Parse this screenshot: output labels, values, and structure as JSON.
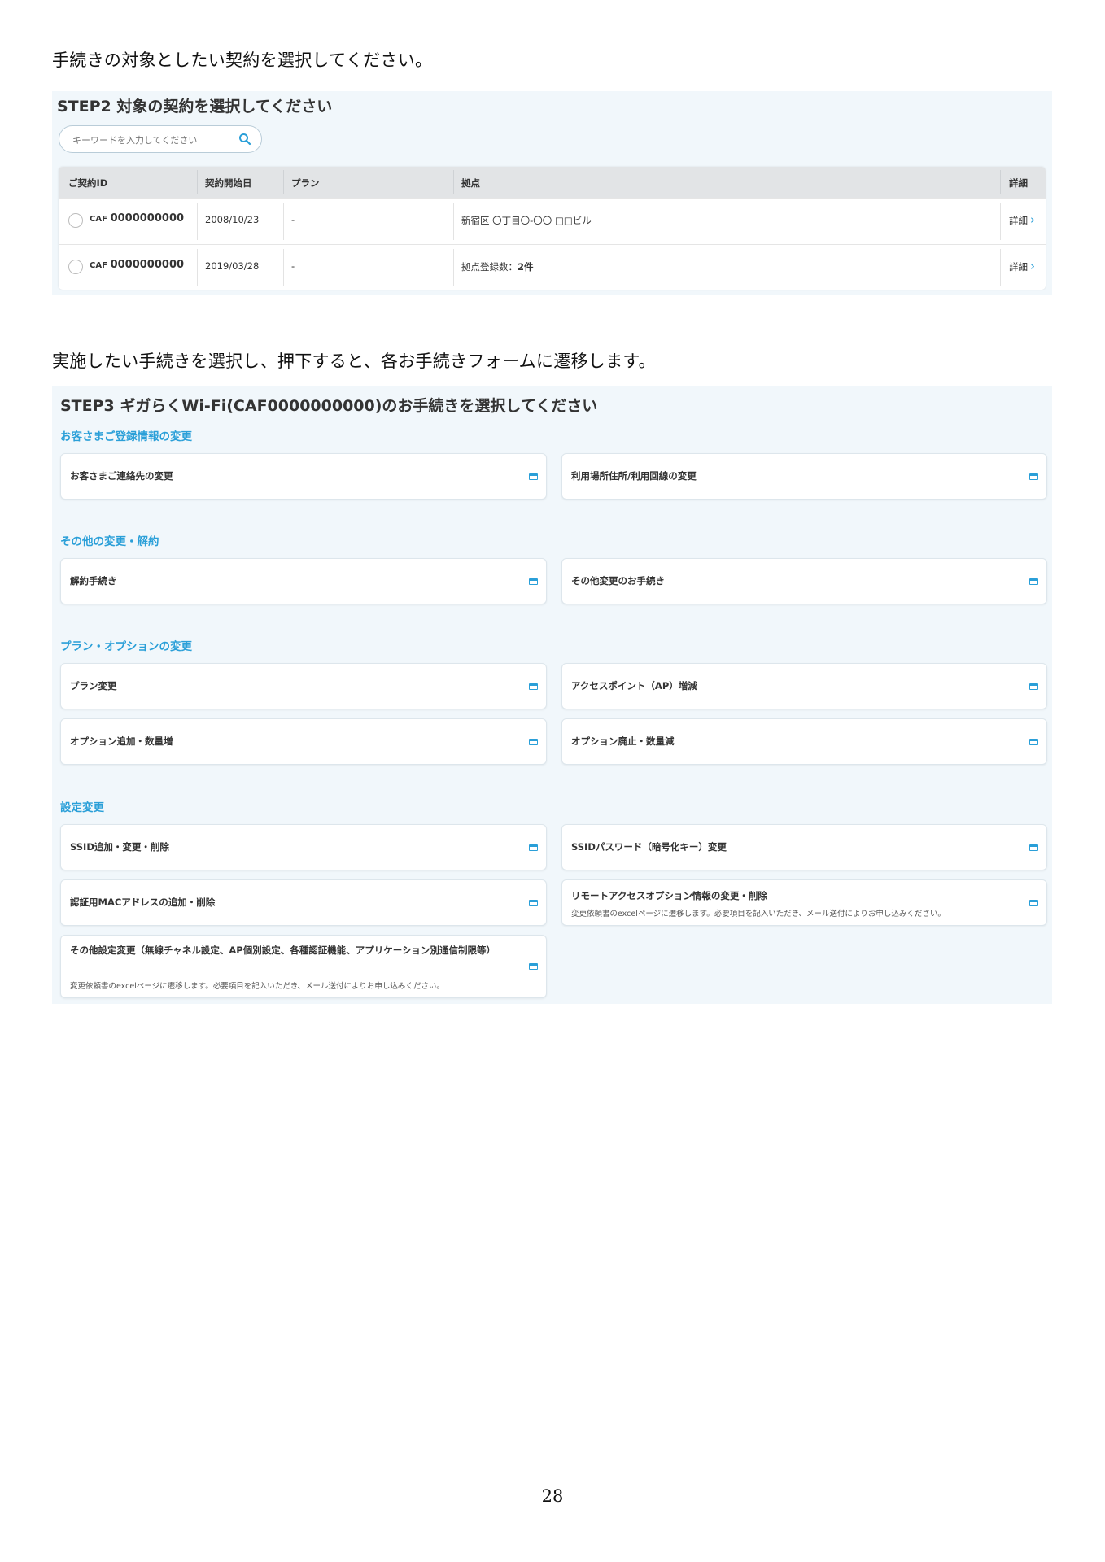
{
  "intro1": "手続きの対象としたい契約を選択してください。",
  "intro2": "実施したい手続きを選択し、押下すると、各お手続きフォームに遷移します。",
  "step2": {
    "title": "STEP2 対象の契約を選択してください",
    "search_placeholder": "キーワードを入力してください",
    "columns": [
      "ご契約ID",
      "契約開始日",
      "プラン",
      "拠点",
      "詳細"
    ],
    "rows": [
      {
        "id_prefix": "CAF",
        "id_num": "0000000000",
        "start": "2008/10/23",
        "plan": "-",
        "site": "新宿区 〇丁目〇-〇〇 □□ビル",
        "site_count": "",
        "detail": "詳細"
      },
      {
        "id_prefix": "CAF",
        "id_num": "0000000000",
        "start": "2019/03/28",
        "plan": "-",
        "site": "拠点登録数：",
        "site_count": "2件",
        "detail": "詳細"
      }
    ]
  },
  "step3": {
    "title": "STEP3 ギガらくWi-Fi(CAF0000000000)のお手続きを選択してください",
    "categories": [
      "お客さまご登録情報の変更",
      "その他の変更・解約",
      "プラン・オプションの変更",
      "設定変更"
    ],
    "cards": [
      {
        "label": "お客さまご連絡先の変更"
      },
      {
        "label": "利用場所住所/利用回線の変更"
      },
      {
        "label": "解約手続き"
      },
      {
        "label": "その他変更のお手続き"
      },
      {
        "label": "プラン変更"
      },
      {
        "label": "アクセスポイント（AP）増減"
      },
      {
        "label": "オプション追加・数量増"
      },
      {
        "label": "オプション廃止・数量減"
      },
      {
        "label": "SSID追加・変更・削除"
      },
      {
        "label": "SSIDパスワード（暗号化キー）変更"
      },
      {
        "label": "認証用MACアドレスの追加・削除"
      },
      {
        "label": "リモートアクセスオプション情報の変更・削除",
        "sub": "変更依頼書のexcelページに遷移します。必要項目を記入いただき、メール送付によりお申し込みください。"
      },
      {
        "label": "その他設定変更（無線チャネル設定、AP個別設定、各種認証機能、アプリケーション別通信制限等）",
        "sub": "変更依頼書のexcelページに遷移します。必要項目を記入いただき、メール送付によりお申し込みください。"
      }
    ]
  },
  "colors": {
    "accent": "#2a9fd8",
    "panel_bg": "#f1f7fb",
    "header_bg": "#e2e4e6"
  },
  "page_number": "28"
}
